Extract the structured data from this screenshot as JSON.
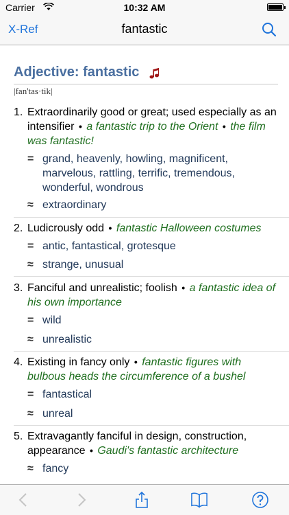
{
  "status": {
    "carrier": "Carrier",
    "time": "10:32 AM"
  },
  "nav": {
    "back_label": "X-Ref",
    "title": "fantastic"
  },
  "entry": {
    "headword": "Adjective: fantastic",
    "pronunciation": "|fan'tas·tik|",
    "senses": [
      {
        "num": "1.",
        "definition": "Extraordinarily good or great; used especially as an intensifier",
        "examples": [
          "a fantastic trip to the Orient",
          "the film was fantastic!"
        ],
        "synonyms": "grand, heavenly, howling, magnificent, marvelous, rattling, terrific, tremendous, wonderful, wondrous",
        "similar": "extraordinary"
      },
      {
        "num": "2.",
        "definition": "Ludicrously odd",
        "examples": [
          "fantastic Halloween costumes"
        ],
        "synonyms": "antic, fantastical, grotesque",
        "similar": "strange, unusual"
      },
      {
        "num": "3.",
        "definition": "Fanciful and unrealistic; foolish",
        "examples": [
          "a fantastic idea of his own importance"
        ],
        "synonyms": "wild",
        "similar": "unrealistic"
      },
      {
        "num": "4.",
        "definition": "Existing in fancy only",
        "examples": [
          "fantastic figures with bulbous heads the circumference of a bushel"
        ],
        "synonyms": "fantastical",
        "similar": "unreal"
      },
      {
        "num": "5.",
        "definition": "Extravagantly fanciful in design, construction, appearance",
        "examples": [
          "Gaudi's fantastic architecture"
        ],
        "synonyms": "",
        "similar": "fancy"
      }
    ],
    "marks": {
      "synonym": "=",
      "similar": "≈",
      "bullet": "•"
    }
  },
  "colors": {
    "accent": "#1f74db",
    "headword": "#4a6fa0",
    "example": "#1e6e1e",
    "synonym": "#233a5a",
    "sound_icon": "#a01818"
  },
  "toolbar": {
    "icons": [
      "back-arrow-icon",
      "forward-arrow-icon",
      "share-icon",
      "book-icon",
      "help-icon"
    ]
  }
}
